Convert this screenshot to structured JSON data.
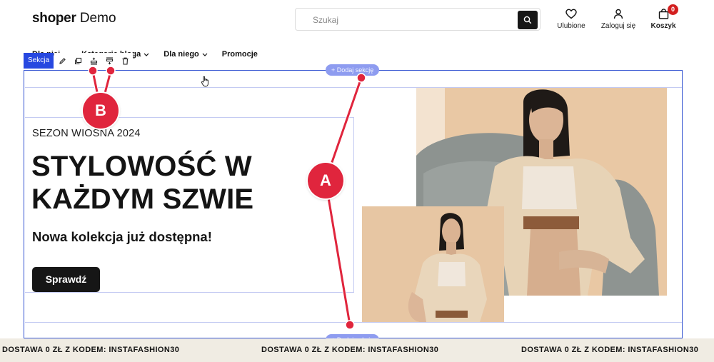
{
  "header": {
    "logo_bold": "shoper",
    "logo_regular": " Demo",
    "search_placeholder": "Szukaj",
    "favorites_label": "Ulubione",
    "login_label": "Zaloguj się",
    "cart_label": "Koszyk",
    "cart_count": "0"
  },
  "nav": {
    "items": [
      {
        "label": "Dla niej"
      },
      {
        "label": "Kategorie bloga"
      },
      {
        "label": "Dla niego"
      },
      {
        "label": "Promocje"
      }
    ]
  },
  "editor": {
    "section_label": "Sekcja",
    "add_section_top": "+ Dodaj sekcję",
    "add_section_bottom": "+ Dodaj sekcję",
    "toolbar_icons": [
      "pencil-icon",
      "duplicate-icon",
      "insert-above-icon",
      "insert-below-icon",
      "trash-icon"
    ]
  },
  "hero": {
    "eyebrow": "SEZON WIOSNA 2024",
    "headline": "STYLOWOŚĆ W KAŻDYM SZWIE",
    "subheadline": "Nowa kolekcja już dostępna!",
    "cta_label": "Sprawdź"
  },
  "annotations": {
    "marker_a": "A",
    "marker_b": "B",
    "color": "#e0253d"
  },
  "marquee": {
    "texts": [
      "DOSTAWA 0 ZŁ Z KODEM: INSTAFASHION30",
      "DOSTAWA 0 ZŁ Z KODEM: INSTAFASHION30",
      "DOSTAWA 0 ZŁ Z KODEM: INSTAFASHION30"
    ]
  },
  "colors": {
    "editor_blue": "#3454d1",
    "section_tab": "#2748e0",
    "add_pill": "#8e9cf0",
    "marquee_bg": "#f0ece3",
    "dark": "#161616"
  }
}
